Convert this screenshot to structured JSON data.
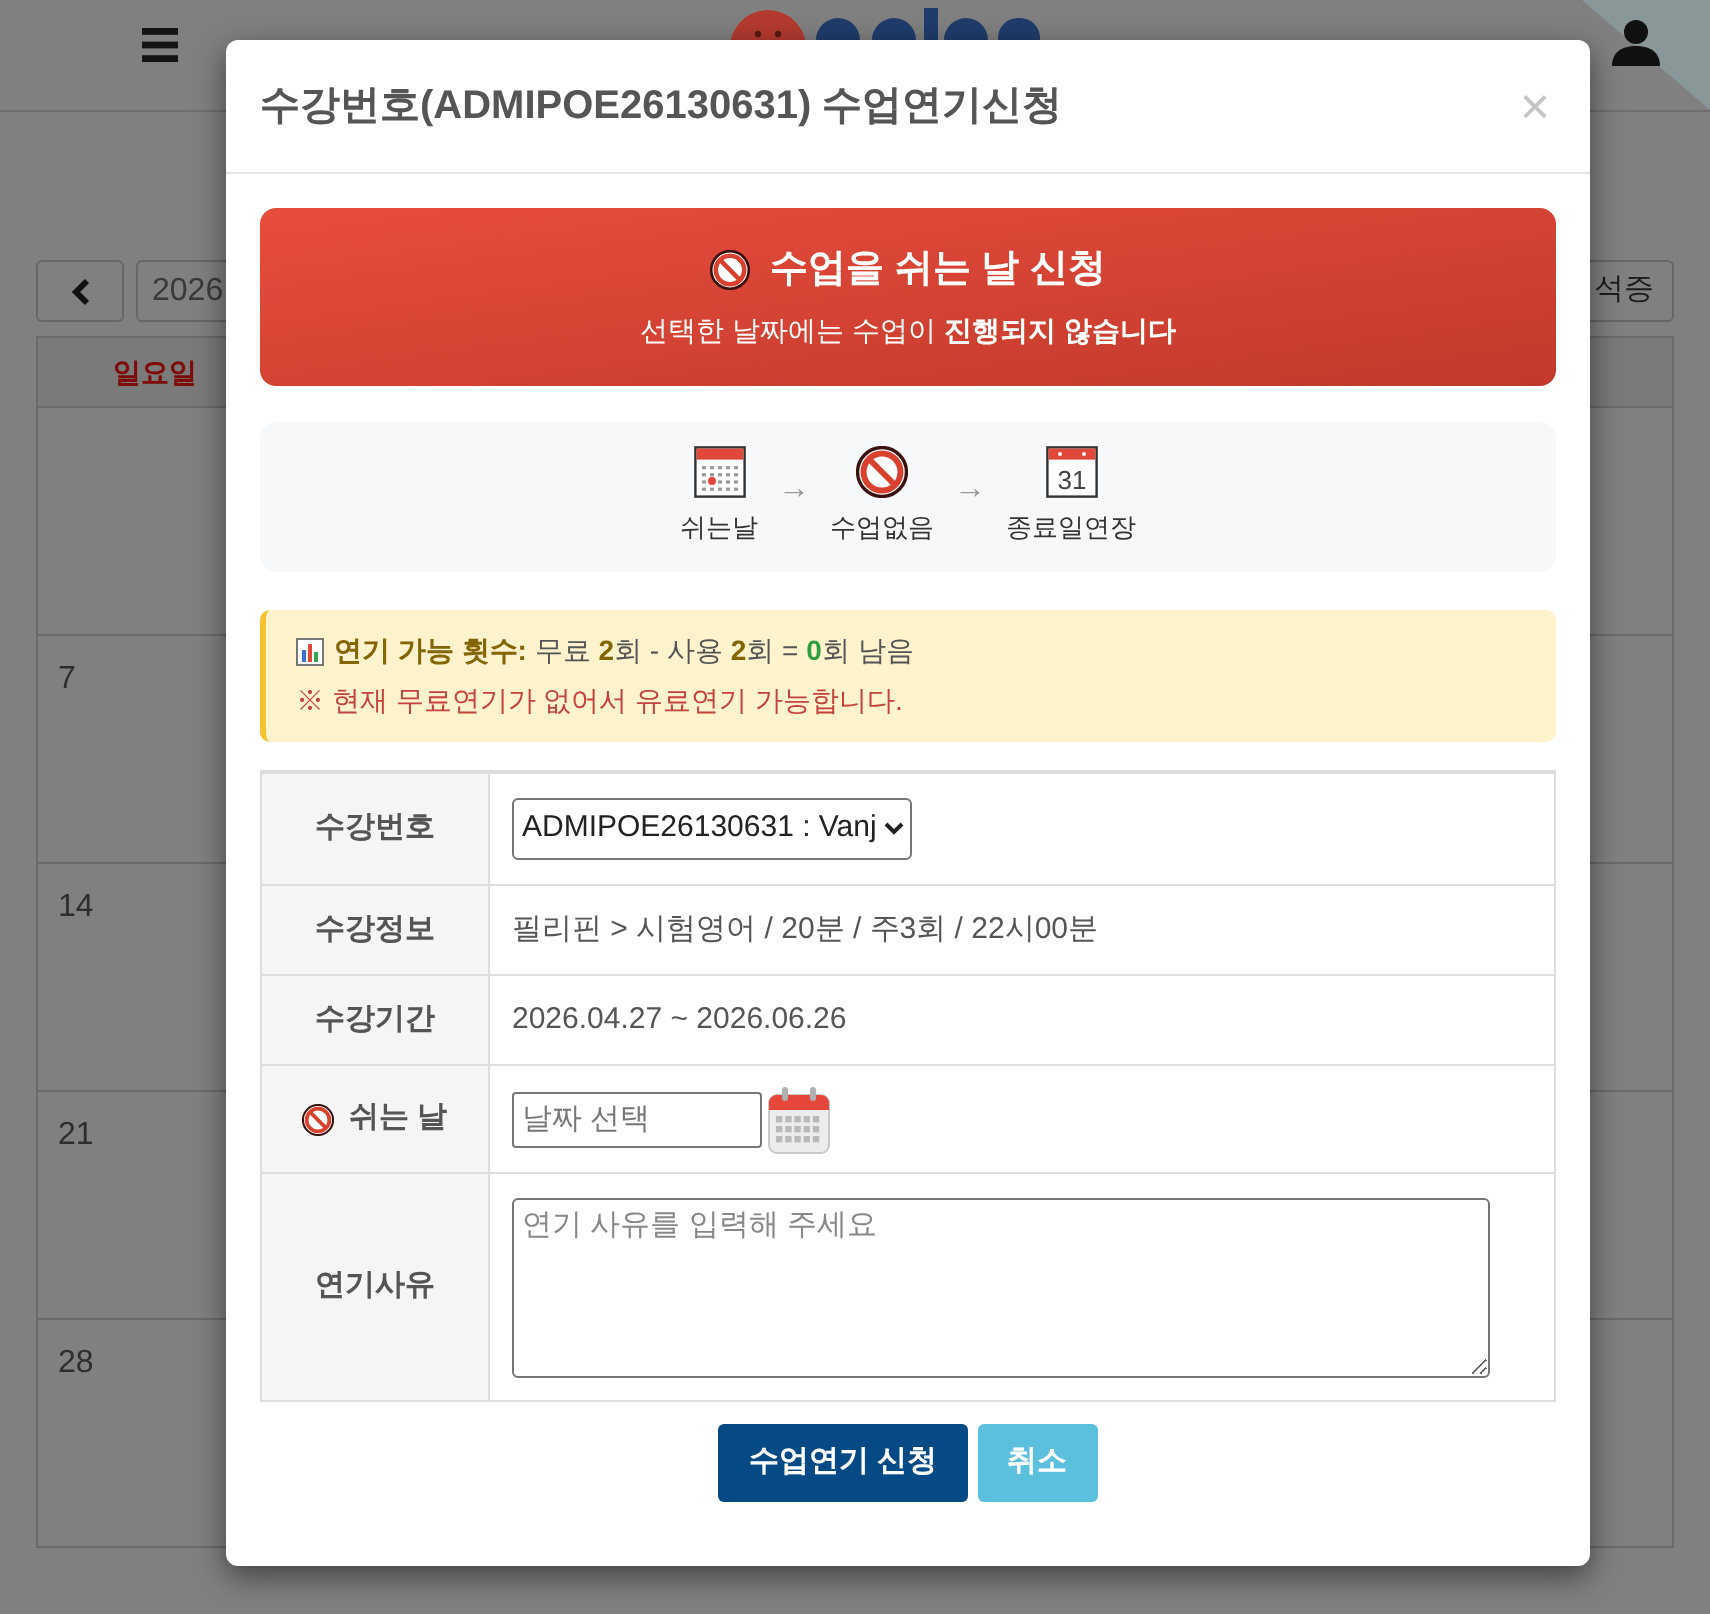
{
  "page": {
    "nav": {
      "date_field": "2026",
      "right_button": "석증"
    },
    "calendar": {
      "weekday_header": "일요일",
      "starts_midweek": true,
      "weeks": [
        {
          "sunday": "7"
        },
        {
          "sunday": "14"
        },
        {
          "sunday": "21"
        },
        {
          "sunday": "28"
        }
      ]
    }
  },
  "modal": {
    "title": "수강번호(ADMIPOE26130631) 수업연기신청",
    "close": "×",
    "banner": {
      "title": "수업을 쉬는 날 신청",
      "subtitle": "선택한 날짜에는 수업이 **진행되지 않습니다**"
    },
    "steps": [
      {
        "kind": "calendar-mark",
        "label": "쉬는날"
      },
      {
        "kind": "prohibited",
        "label": "수업없음",
        "arrow_before": "→"
      },
      {
        "kind": "calendar-date",
        "label": "종료일연장",
        "arrow_before": "→",
        "icon_text": "31"
      }
    ],
    "notice": {
      "label": "연기 가능 횟수:",
      "parts": [
        {
          "kind": "text",
          "text": " 무료 "
        },
        {
          "kind": "count",
          "text": "2"
        },
        {
          "kind": "text",
          "text": "회 - 사용 "
        },
        {
          "kind": "count",
          "text": "2"
        },
        {
          "kind": "text",
          "text": "회 = "
        },
        {
          "kind": "remaining",
          "text": "0"
        },
        {
          "kind": "text",
          "text": "회 남음"
        }
      ],
      "warning": "※ 현재 무료연기가 없어서 유료연기 가능합니다."
    },
    "form": {
      "rows": [
        {
          "kind": "select",
          "label": "수강번호",
          "value": "ADMIPOE26130631 : Vanj"
        },
        {
          "kind": "text",
          "label": "수강정보",
          "value": "필리핀 > 시험영어 / 20분 / 주3회 / 22시00분"
        },
        {
          "kind": "text",
          "label": "수강기간",
          "value": "2026.04.27 ~ 2026.06.26"
        },
        {
          "kind": "date",
          "label": "쉬는 날",
          "placeholder": "날짜 선택"
        },
        {
          "kind": "textarea",
          "label": "연기사유",
          "placeholder": "연기 사유를 입력해 주세요"
        }
      ]
    },
    "buttons": [
      {
        "kind": "primary",
        "label": "수업연기 신청"
      },
      {
        "kind": "secondary",
        "label": "취소"
      }
    ]
  }
}
